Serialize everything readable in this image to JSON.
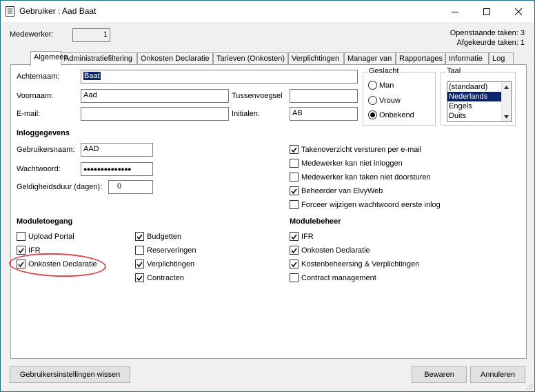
{
  "window": {
    "title": "Gebruiker : Aad Baat"
  },
  "header": {
    "medewerker_label": "Medewerker:",
    "medewerker_value": "1",
    "open_tasks": "Openstaande taken: 3",
    "rejected_tasks": "Afgekeurde taken: 1"
  },
  "tabs": [
    {
      "label": "Algemeen"
    },
    {
      "label": "Administratiefiltering"
    },
    {
      "label": "Onkosten Declaratie"
    },
    {
      "label": "Tarieven (Onkosten)"
    },
    {
      "label": "Verplichtingen"
    },
    {
      "label": "Manager van"
    },
    {
      "label": "Rapportages"
    },
    {
      "label": "Informatie"
    },
    {
      "label": "Log"
    }
  ],
  "form": {
    "achternaam_label": "Achternaam:",
    "achternaam_value": "Baat",
    "voornaam_label": "Voornaam:",
    "voornaam_value": "Aad",
    "tussenvoegsel_label": "Tussenvoegsel",
    "tussenvoegsel_value": "",
    "email_label": "E-mail:",
    "email_value": "",
    "initialen_label": "Initialen:",
    "initialen_value": "AB"
  },
  "geslacht": {
    "label": "Geslacht",
    "options": [
      {
        "label": "Man",
        "selected": false
      },
      {
        "label": "Vrouw",
        "selected": false
      },
      {
        "label": "Onbekend",
        "selected": true
      }
    ]
  },
  "taal": {
    "label": "Taal",
    "options": [
      {
        "label": "(standaard)",
        "selected": false
      },
      {
        "label": "Nederlands",
        "selected": true
      },
      {
        "label": "Engels",
        "selected": false
      },
      {
        "label": "Duits",
        "selected": false
      }
    ]
  },
  "login": {
    "heading": "Inloggegevens",
    "username_label": "Gebruikersnaam:",
    "username_value": "AAD",
    "password_label": "Wachtwoord:",
    "password_value": "●●●●●●●●●●●●●●",
    "validity_label": "Geldigheidsduur (dagen):",
    "validity_value": "0"
  },
  "options": [
    {
      "label": "Takenoverzicht versturen per e-mail",
      "checked": true
    },
    {
      "label": "Medewerker kan niet inloggen",
      "checked": false
    },
    {
      "label": "Medewerker kan taken niet doorsturen",
      "checked": false
    },
    {
      "label": "Beheerder van ElvyWeb",
      "checked": true
    },
    {
      "label": "Forceer wijzigen wachtwoord eerste inlog",
      "checked": false
    }
  ],
  "module_access": {
    "heading": "Moduletoegang",
    "col1": [
      {
        "label": "Upload Portal",
        "checked": false
      },
      {
        "label": "IFR",
        "checked": true
      },
      {
        "label": "Onkosten Declaratie",
        "checked": true
      }
    ],
    "col2": [
      {
        "label": "Budgetten",
        "checked": true
      },
      {
        "label": "Reserveringen",
        "checked": false
      },
      {
        "label": "Verplichtingen",
        "checked": true
      },
      {
        "label": "Contracten",
        "checked": true
      }
    ]
  },
  "module_management": {
    "heading": "Modulebeheer",
    "items": [
      {
        "label": "IFR",
        "checked": true
      },
      {
        "label": "Onkosten Declaratie",
        "checked": true
      },
      {
        "label": "Kostenbeheersing & Verplichtingen",
        "checked": true
      },
      {
        "label": "Contract management",
        "checked": false
      }
    ]
  },
  "footer": {
    "reset_label": "Gebruikersinstellingen wissen",
    "save_label": "Bewaren",
    "cancel_label": "Annuleren"
  },
  "colors": {
    "selection": "#0a246a",
    "highlight_annotation": "#e0424a"
  }
}
